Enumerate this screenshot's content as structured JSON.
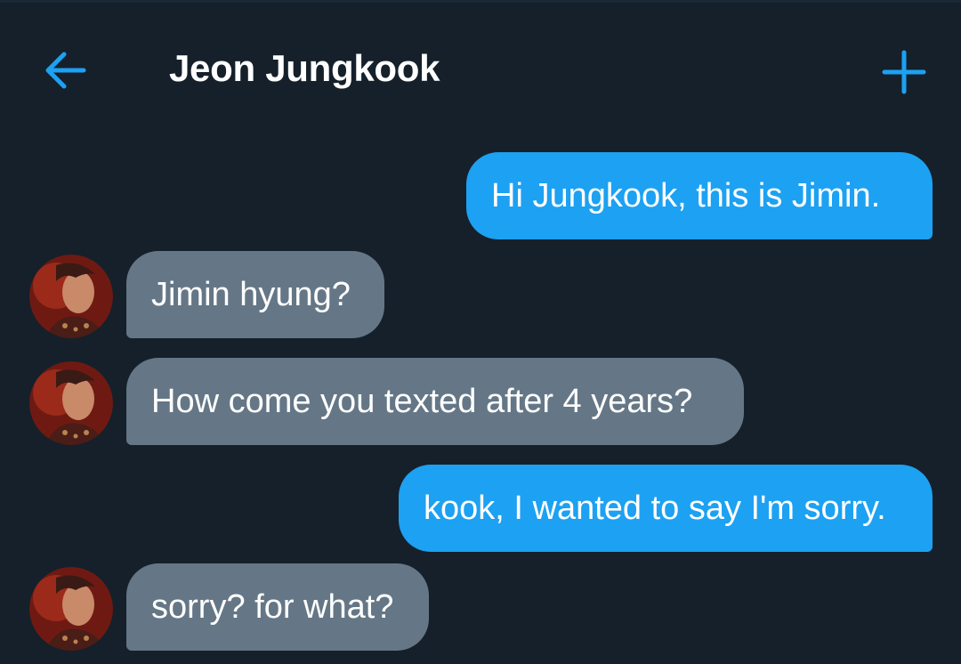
{
  "header": {
    "back_icon": "arrow-left-icon",
    "title": "Jeon Jungkook",
    "new_icon": "plus-icon",
    "accent": "#1da1f2"
  },
  "theme": {
    "background": "#15202b",
    "sent_bubble": "#1da1f2",
    "received_bubble": "#657786",
    "text": "#ffffff"
  },
  "messages": [
    {
      "from": "me",
      "text": "Hi Jungkook, this is Jimin."
    },
    {
      "from": "them",
      "text": "Jimin hyung?"
    },
    {
      "from": "them",
      "text": "How come you texted after 4 years?"
    },
    {
      "from": "me",
      "text": "kook, I wanted to say I'm sorry."
    },
    {
      "from": "them",
      "text": "sorry? for what?"
    }
  ]
}
